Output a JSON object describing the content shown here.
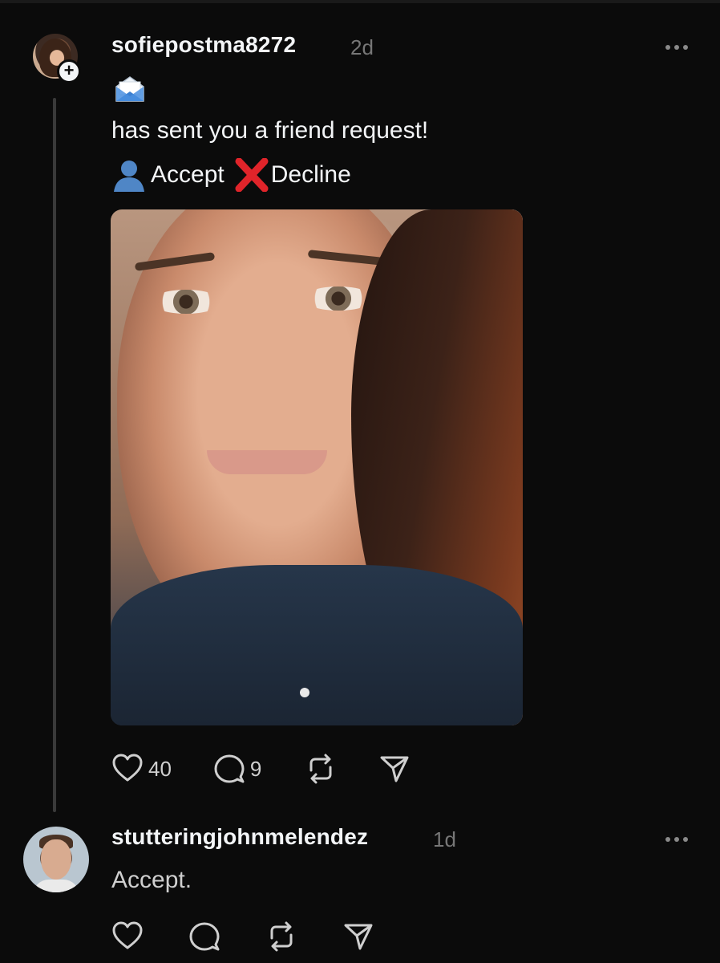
{
  "post": {
    "username": "sofiepostma8272",
    "time": "2d",
    "line1": "has sent you a friend request!",
    "accept_label": "Accept",
    "decline_label": "Decline",
    "likes": "40",
    "comments": "9",
    "icons": [
      "envelope-icon",
      "person-icon",
      "x-icon",
      "heart-icon",
      "comment-icon",
      "repost-icon",
      "share-icon",
      "more-icon"
    ]
  },
  "reply": {
    "username": "stutteringjohnmelendez",
    "time": "1d",
    "text": "Accept."
  },
  "colors": {
    "background": "#0b0b0b",
    "text": "#f3f5f7",
    "muted": "#777777",
    "thread_line": "#3a3a3a",
    "x_red": "#e0242a"
  }
}
